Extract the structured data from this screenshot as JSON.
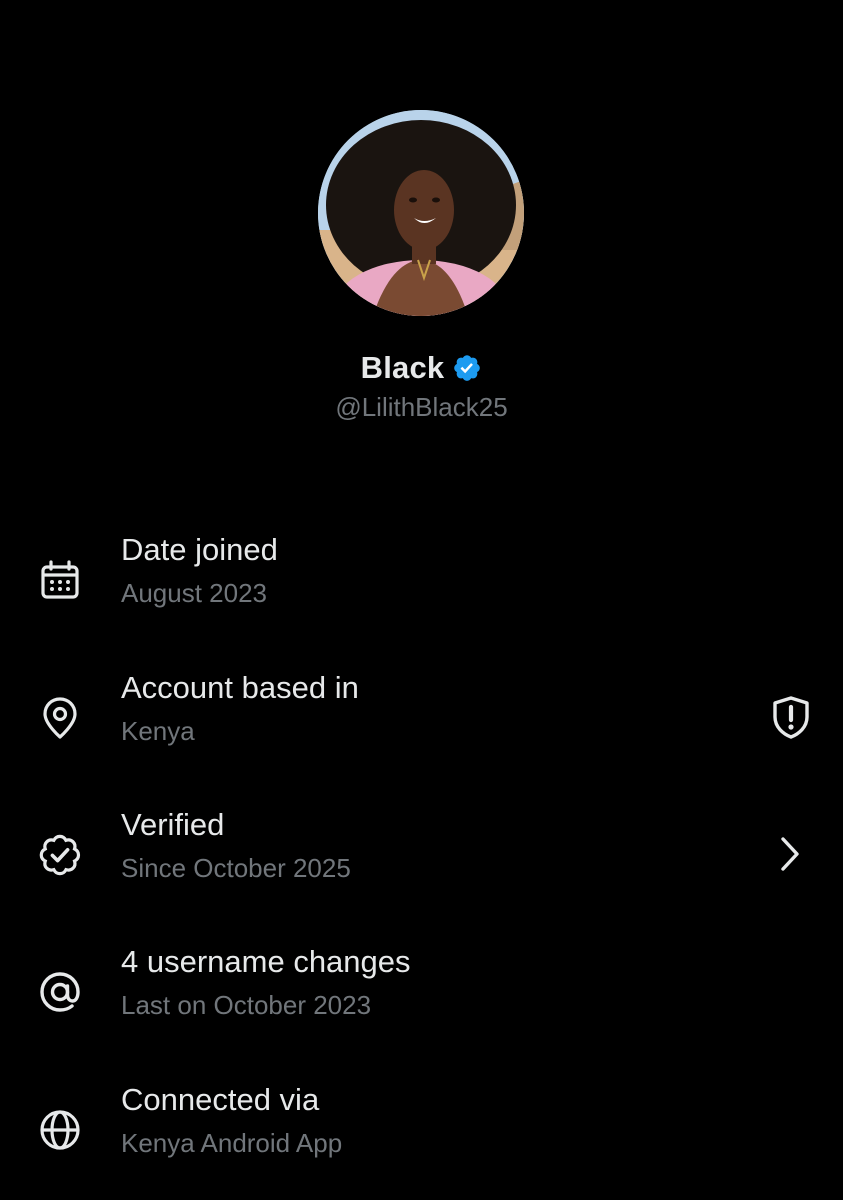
{
  "profile": {
    "display_name": "Black",
    "handle": "@LilithBlack25",
    "verified_badge_color": "#1d9bf0",
    "avatar": "profile-photo"
  },
  "about_rows": [
    {
      "icon": "calendar-icon",
      "title": "Date joined",
      "subtitle": "August 2023",
      "trailing": null
    },
    {
      "icon": "location-pin-icon",
      "title": "Account based in",
      "subtitle": "Kenya",
      "trailing": "shield-alert-icon"
    },
    {
      "icon": "verified-check-icon",
      "title": "Verified",
      "subtitle": "Since October 2025",
      "trailing": "chevron-right-icon"
    },
    {
      "icon": "at-sign-icon",
      "title": "4 username changes",
      "subtitle": "Last on October 2023",
      "trailing": null
    },
    {
      "icon": "globe-icon",
      "title": "Connected via",
      "subtitle": "Kenya Android App",
      "trailing": null
    }
  ],
  "colors": {
    "background": "#000000",
    "primary_text": "#e7e9ea",
    "secondary_text": "#71767b",
    "accent": "#1d9bf0"
  }
}
